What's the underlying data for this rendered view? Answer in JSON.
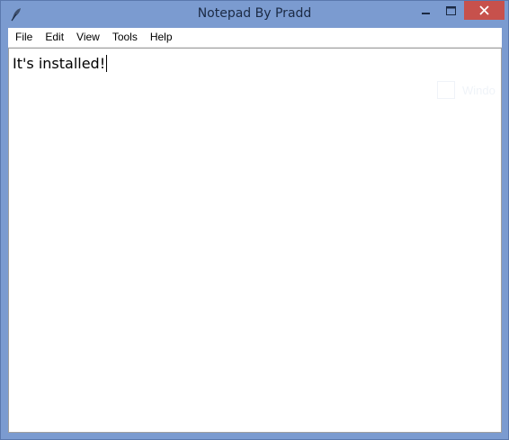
{
  "window": {
    "title": "Notepad By Pradd",
    "app_icon": "feather-pen-icon",
    "controls": {
      "minimize_icon": "minimize-icon",
      "maximize_icon": "maximize-icon",
      "close_icon": "close-icon"
    }
  },
  "menu": {
    "items": [
      "File",
      "Edit",
      "View",
      "Tools",
      "Help"
    ]
  },
  "editor": {
    "content": "It's installed!"
  },
  "watermark": {
    "text": "Windo"
  },
  "colors": {
    "titlebar": "#7b9bd0",
    "close_button": "#c7514c",
    "menubar": "#ffffff",
    "editor_background": "#ffffff"
  }
}
